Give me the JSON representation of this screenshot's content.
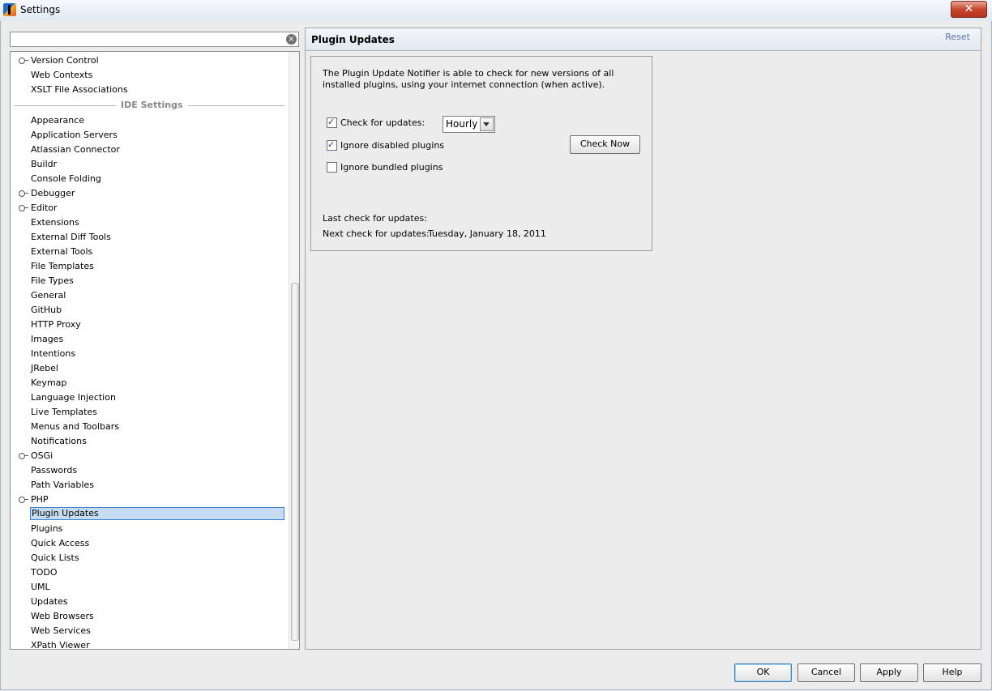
{
  "window": {
    "title": "Settings",
    "close_icon": "close-icon"
  },
  "search": {
    "value": "",
    "placeholder": ""
  },
  "tree": {
    "items_top": [
      {
        "label": "Version Control",
        "expandable": true
      },
      {
        "label": "Web Contexts",
        "expandable": false
      },
      {
        "label": "XSLT File Associations",
        "expandable": false
      }
    ],
    "group_label": "IDE Settings",
    "items": [
      {
        "label": "Appearance",
        "expandable": false
      },
      {
        "label": "Application Servers",
        "expandable": false
      },
      {
        "label": "Atlassian Connector",
        "expandable": false
      },
      {
        "label": "Buildr",
        "expandable": false
      },
      {
        "label": "Console Folding",
        "expandable": false
      },
      {
        "label": "Debugger",
        "expandable": true
      },
      {
        "label": "Editor",
        "expandable": true
      },
      {
        "label": "Extensions",
        "expandable": false
      },
      {
        "label": "External Diff Tools",
        "expandable": false
      },
      {
        "label": "External Tools",
        "expandable": false
      },
      {
        "label": "File Templates",
        "expandable": false
      },
      {
        "label": "File Types",
        "expandable": false
      },
      {
        "label": "General",
        "expandable": false
      },
      {
        "label": "GitHub",
        "expandable": false
      },
      {
        "label": "HTTP Proxy",
        "expandable": false
      },
      {
        "label": "Images",
        "expandable": false
      },
      {
        "label": "Intentions",
        "expandable": false
      },
      {
        "label": "JRebel",
        "expandable": false
      },
      {
        "label": "Keymap",
        "expandable": false
      },
      {
        "label": "Language Injection",
        "expandable": false
      },
      {
        "label": "Live Templates",
        "expandable": false
      },
      {
        "label": "Menus and Toolbars",
        "expandable": false
      },
      {
        "label": "Notifications",
        "expandable": false
      },
      {
        "label": "OSGi",
        "expandable": true
      },
      {
        "label": "Passwords",
        "expandable": false
      },
      {
        "label": "Path Variables",
        "expandable": false
      },
      {
        "label": "PHP",
        "expandable": true
      },
      {
        "label": "Plugin Updates",
        "expandable": false,
        "selected": true
      },
      {
        "label": "Plugins",
        "expandable": false
      },
      {
        "label": "Quick Access",
        "expandable": false
      },
      {
        "label": "Quick Lists",
        "expandable": false
      },
      {
        "label": "TODO",
        "expandable": false
      },
      {
        "label": "UML",
        "expandable": false
      },
      {
        "label": "Updates",
        "expandable": false
      },
      {
        "label": "Web Browsers",
        "expandable": false
      },
      {
        "label": "Web Services",
        "expandable": false
      },
      {
        "label": "XPath Viewer",
        "expandable": false
      }
    ]
  },
  "panel": {
    "title": "Plugin Updates",
    "reset_label": "Reset",
    "description": "The Plugin Update Notifier is able to check for new versions of all installed plugins, using your internet connection (when active).",
    "check_for_updates": {
      "label": "Check for updates:",
      "checked": true
    },
    "frequency": {
      "value": "Hourly"
    },
    "ignore_disabled": {
      "label": "Ignore disabled plugins",
      "checked": true
    },
    "ignore_bundled": {
      "label": "Ignore bundled plugins",
      "checked": false
    },
    "check_now_label": "Check Now",
    "last_check_label": "Last check for updates:",
    "last_check_value": "",
    "next_check_label": "Next check for updates:",
    "next_check_value": "Tuesday, January 18, 2011"
  },
  "footer": {
    "ok_label": "OK",
    "cancel_label": "Cancel",
    "apply_label": "Apply",
    "help_label": "Help"
  }
}
